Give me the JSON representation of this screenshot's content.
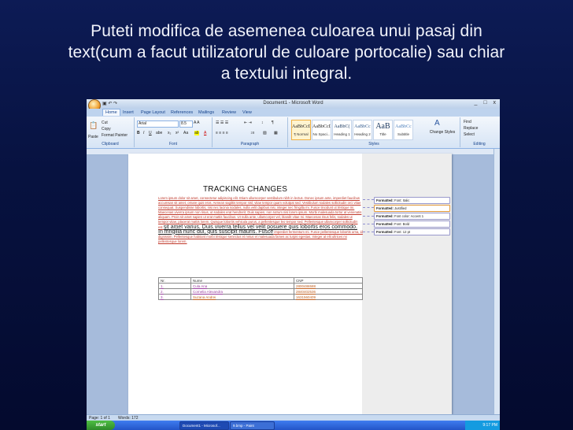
{
  "slide": {
    "title_line1": "Puteti modifica de asemenea culoarea unui pasaj din",
    "title_line2": "text(cum a facut utilizatorul de culoare portocalie) sau chiar",
    "title_line3": "a textului integral."
  },
  "window": {
    "title": "Document1 - Microsoft Word",
    "controls": "_ □ x"
  },
  "ribbon": {
    "tabs": [
      "Home",
      "Insert",
      "Page Layout",
      "References",
      "Mailings",
      "Review",
      "View"
    ],
    "clipboard": {
      "paste": "Paste",
      "cut": "Cut",
      "copy": "Copy",
      "format_painter": "Format Painter",
      "label": "Clipboard"
    },
    "font": {
      "name": "Arial",
      "size": "8.5",
      "label": "Font"
    },
    "paragraph": {
      "label": "Paragraph"
    },
    "styles": {
      "items": [
        {
          "sample": "AaBbCcDc",
          "name": "¶ Normal"
        },
        {
          "sample": "AaBbCcDc",
          "name": "No Spaci..."
        },
        {
          "sample": "AaBbC(",
          "name": "Heading 1"
        },
        {
          "sample": "AaBbCc",
          "name": "Heading 2"
        },
        {
          "sample": "AaB",
          "name": "Title"
        },
        {
          "sample": "AaBbCc",
          "name": "Subtitle"
        }
      ],
      "change_styles": "Change Styles",
      "label": "Styles"
    },
    "editing": {
      "find": "Find",
      "replace": "Replace",
      "select": "Select",
      "label": "Editing"
    }
  },
  "document": {
    "heading": "TRACKING CHANGES",
    "paragraph": {
      "p1": "Lorem ipsum dolor sit amet, consectetur adipiscing elit. Etiam ullamcorper vestibulum nibh in lectus. Donec ipsum ante, imperdiet faucibus accumsan sit amet, ornare quis eros. Aenean sagittis tempor nisl, vitae tempor quam volutpat sed. Vestibulum sodales sollicitudin orci vitae consequat. Suspendisse lobortis, nisi nec lacinia sodales, nulla velit dapibus nisi, integer nec fringilla mi. Fusce tincidunt ut tristique mi. Maecenas viverra ipsum non risus, ut sodales erat hendrerit. Duis sapien, non rutrum nisi lorem ipsum. Morbi malesuada tortor at venenatis aliquam. Proin sit amet sapien ut erat mattis faucibus. Ut nulla ante, ullamcorper vel, blandit vitae mi. Maecenas risus felis, sodales ut tempor vitae, placerat mattis lorem. Quisque lobortis vehicula purus, a pellentesque leo tempor sed. Pellentesque ullamcorper sollicitudin est ",
      "big": "sit amet varius. Duis viverra tellus vel velit posuere quis lobortis eros commodo. In fringilla nunc dui, quis suscipit mauris. Fusce",
      "p2": " imperdiet fermentum mi. Fusce pellentesque lobortis urna, id dignissim. Pellentesque habitant morbi tristique senectus et netus et malesuada fames ac turpis egestas. Integer at elit ultrices mi pellentesque lorem."
    },
    "balloons": [
      {
        "label": "Formatted:",
        "value": "Font: Italic"
      },
      {
        "label": "Formatted:",
        "value": "Justified"
      },
      {
        "label": "Formatted:",
        "value": "Font color: Accent 1"
      },
      {
        "label": "Formatted:",
        "value": "Font: Bold"
      },
      {
        "label": "Formatted:",
        "value": "Font: 12 pt"
      }
    ],
    "table": {
      "headers": [
        "Nr.",
        "Nume",
        "CNP"
      ],
      "rows": [
        [
          "1.",
          "Cula Ana",
          "2800486588"
        ],
        [
          "2.",
          "Cornelia Alexandra",
          "2840402536"
        ],
        [
          "3.",
          "Suzana Andrei",
          "1631560409"
        ]
      ]
    }
  },
  "status": {
    "page": "Page: 1 of 1",
    "words": "Words: 172"
  },
  "taskbar": {
    "start": "start",
    "tasks": [
      "Document1 - Microsof...",
      "9.bmp - Paint"
    ],
    "clock": "9:17 PM"
  }
}
